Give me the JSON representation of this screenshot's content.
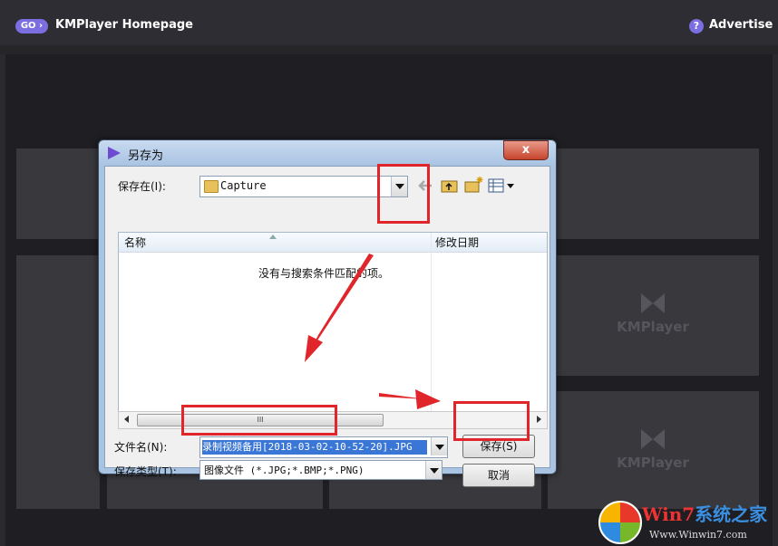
{
  "app": {
    "go_label": "GO ›",
    "homepage_label": "KMPlayer Homepage",
    "advertise_icon": "?",
    "advertise_label": "Advertise",
    "tile_logo": "KMPlayer"
  },
  "dialog": {
    "title": "另存为",
    "close_label": "x",
    "save_in_label": "保存在(I):",
    "folder_value": "Capture",
    "columns": [
      "名称",
      "修改日期"
    ],
    "empty_message": "没有与搜索条件匹配的项。",
    "scroll_grip": "III",
    "filename_label": "文件名(N):",
    "filename_value": "录制视频备用[2018-03-02-10-52-20].JPG",
    "filetype_label": "保存类型(T):",
    "filetype_value": "图像文件 (*.JPG;*.BMP;*.PNG)",
    "save_button": "保存(S)",
    "cancel_button": "取消"
  },
  "watermark": {
    "brand_a": "Win7",
    "brand_b": "系统之家",
    "url": "Www.Winwin7.com"
  },
  "colors": {
    "accent": "#7b6ee0",
    "annotation_red": "#e0262a",
    "selection_blue": "#3a76d6"
  }
}
